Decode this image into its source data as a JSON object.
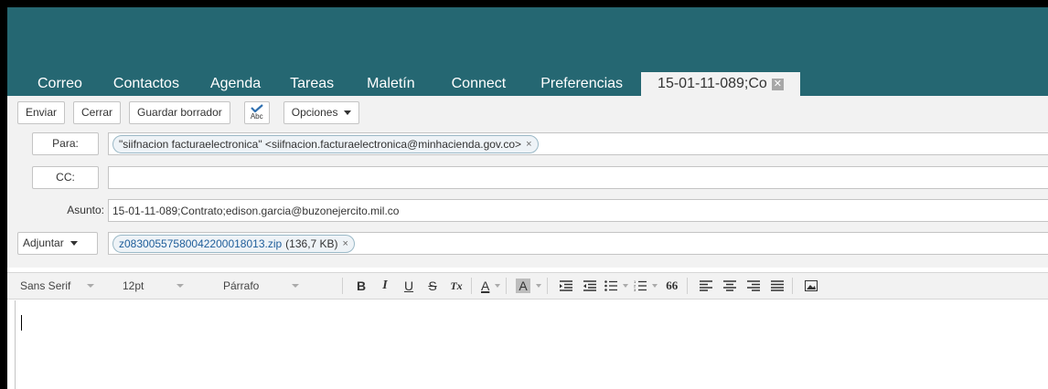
{
  "tabs": [
    {
      "label": "Correo"
    },
    {
      "label": "Contactos"
    },
    {
      "label": "Agenda"
    },
    {
      "label": "Tareas"
    },
    {
      "label": "Maletín"
    },
    {
      "label": "Connect"
    },
    {
      "label": "Preferencias"
    }
  ],
  "active_tab": {
    "label": "15-01-11-089;Co",
    "close": "✕"
  },
  "toolbar": {
    "send_label": "Enviar",
    "close_label": "Cerrar",
    "save_draft_label": "Guardar borrador",
    "spell_label": "Abc",
    "options_label": "Opciones"
  },
  "fields": {
    "to_label": "Para:",
    "to_recipient": "\"siifnacion facturaelectronica\" <siifnacion.facturaelectronica@minhacienda.gov.co>",
    "cc_label": "CC:",
    "subject_label": "Asunto:",
    "subject_value": "15-01-11-089;Contrato;edison.garcia@buzonejercito.mil.co",
    "attach_label": "Adjuntar",
    "attachment_name": "z08300557580042200018013.zip",
    "attachment_size": "(136,7 KB)",
    "remove_symbol": "×"
  },
  "editor_toolbar": {
    "font_family": "Sans Serif",
    "font_size": "12pt",
    "paragraph": "Párrafo",
    "bold": "B",
    "italic": "I",
    "underline": "U",
    "strike": "S",
    "clear_format": "Tx",
    "font_color": "A",
    "bg_color": "A",
    "quote": "66"
  },
  "colors": {
    "header": "#256772",
    "toolbar_bg": "#f2f2f2",
    "link": "#1e5d9a"
  }
}
